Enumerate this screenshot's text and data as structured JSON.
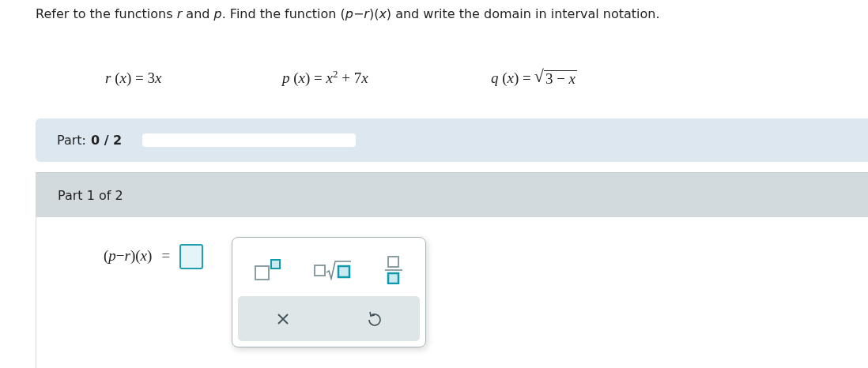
{
  "prompt": "Refer to the functions *r* and *p*. Find the function (*p*−*r*)(*x*) and write the domain in interval notation.",
  "functions": [
    {
      "kind": "plain",
      "parts": [
        {
          "kind": "var",
          "text": "r"
        },
        {
          "kind": "num",
          "text": " ("
        },
        {
          "kind": "var",
          "text": "x"
        },
        {
          "kind": "num",
          "text": ") = 3"
        },
        {
          "kind": "var",
          "text": "x"
        }
      ]
    },
    {
      "kind": "plain",
      "parts": [
        {
          "kind": "var",
          "text": "p"
        },
        {
          "kind": "num",
          "text": " ("
        },
        {
          "kind": "var",
          "text": "x"
        },
        {
          "kind": "num",
          "text": ") = "
        },
        {
          "kind": "var",
          "text": "x"
        },
        {
          "kind": "sup",
          "text": "2"
        },
        {
          "kind": "num",
          "text": " + 7"
        },
        {
          "kind": "var",
          "text": "x"
        }
      ]
    },
    {
      "kind": "sqrt",
      "prefix": "*q* (*x*) =",
      "radical": "√",
      "radicand": "3 − *x*"
    }
  ],
  "progress": {
    "label": "Part:",
    "count": "0 / 2",
    "level": 0
  },
  "part_header": "Part 1 of 2",
  "answer": {
    "label": "(*p*−*r*)(*x*)",
    "equals": "="
  },
  "keypad": {
    "templates": [
      {
        "kind": "power"
      },
      {
        "kind": "root"
      },
      {
        "kind": "fraction"
      }
    ],
    "actions": [
      {
        "kind": "clear"
      },
      {
        "kind": "undo"
      }
    ]
  }
}
